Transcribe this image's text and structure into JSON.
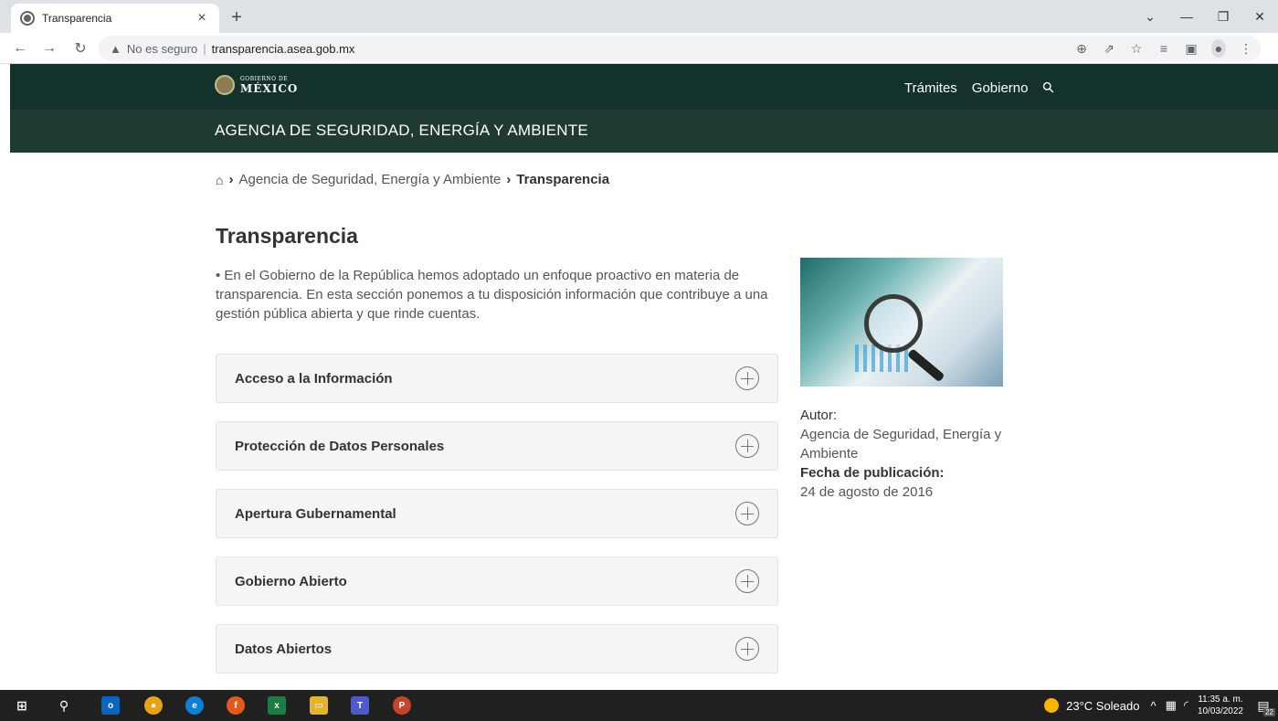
{
  "browser": {
    "tab_title": "Transparencia",
    "tab_close": "×",
    "new_tab": "+",
    "security_label": "No es seguro",
    "url": "transparencia.asea.gob.mx"
  },
  "header": {
    "logo_small": "GOBIERNO DE",
    "logo_big": "MÉXICO",
    "nav": [
      "Trámites",
      "Gobierno"
    ]
  },
  "agency": {
    "name": "AGENCIA DE SEGURIDAD, ENERGÍA Y AMBIENTE"
  },
  "breadcrumb": {
    "items": [
      "Agencia de Seguridad, Energía y Ambiente",
      "Transparencia"
    ]
  },
  "main": {
    "title": "Transparencia",
    "intro": "En el Gobierno de la República hemos adoptado un enfoque proactivo en materia de transparencia. En esta sección ponemos a tu disposición información que contribuye a una gestión pública abierta y que rinde cuentas.",
    "accordions": [
      "Acceso a la Información",
      "Protección de Datos Personales",
      "Apertura Gubernamental",
      "Gobierno Abierto",
      "Datos Abiertos"
    ]
  },
  "sidebar": {
    "author_label": "Autor:",
    "author": "Agencia de Seguridad, Energía y Ambiente",
    "date_label": "Fecha de publicación:",
    "date": "24 de agosto de 2016"
  },
  "taskbar": {
    "weather": "23°C Soleado",
    "time": "11:35 a. m.",
    "date": "10/03/2022",
    "notifications": "22"
  },
  "colors": {
    "header_bg": "#13322b",
    "agency_bg": "#1e3a33",
    "accordion_bg": "#f5f5f5"
  }
}
